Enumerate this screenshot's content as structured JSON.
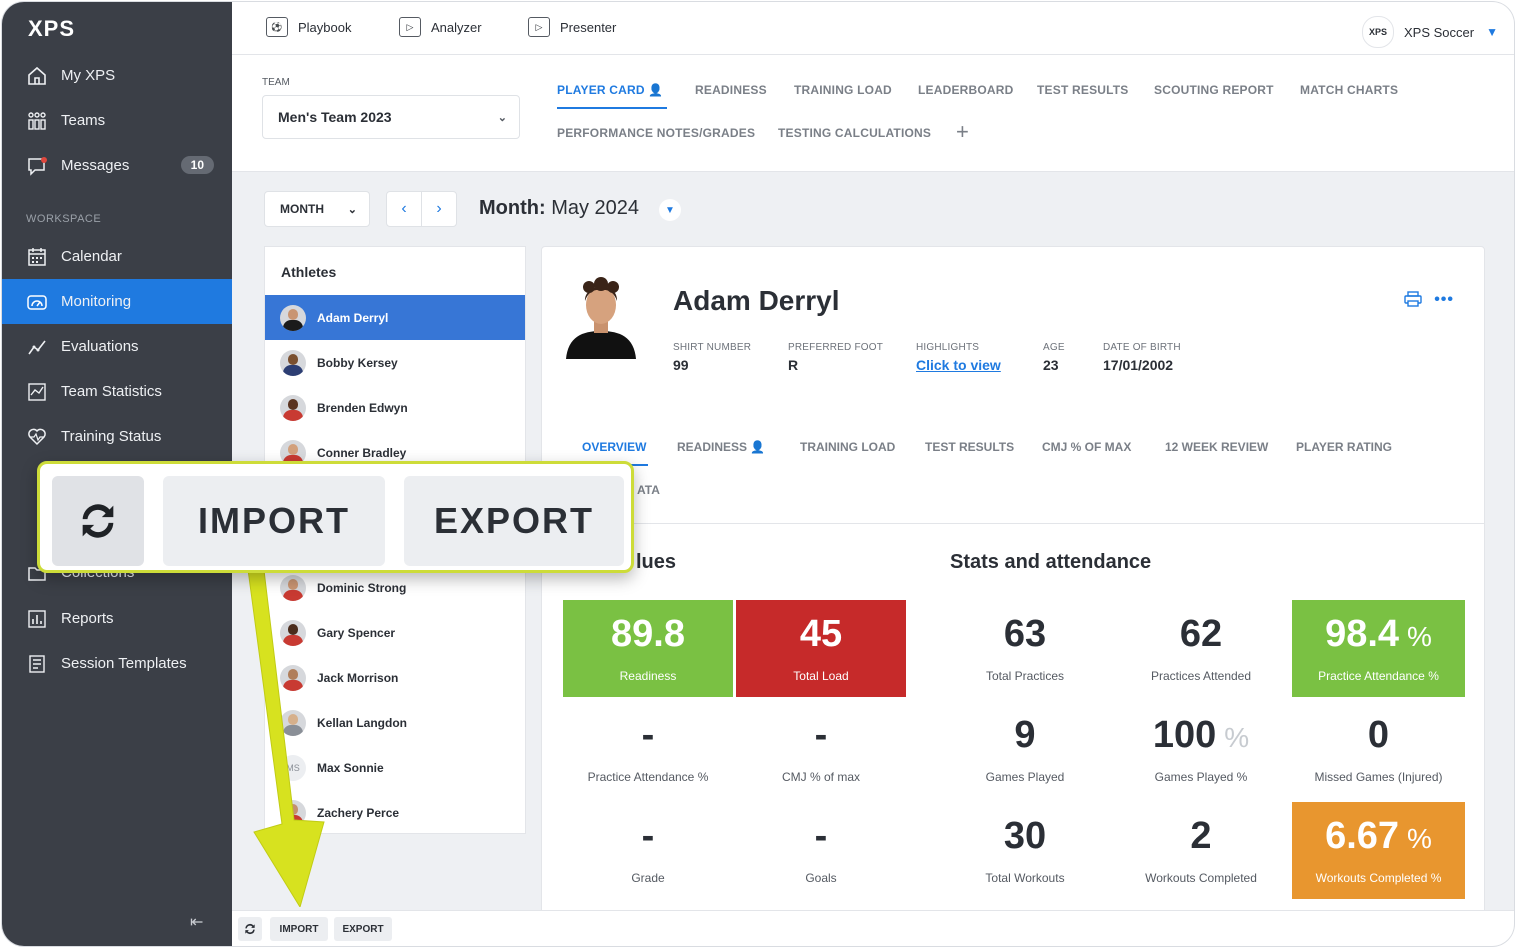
{
  "sidebar": {
    "logo": "XPS",
    "items": [
      {
        "label": "My XPS",
        "icon": "home-icon"
      },
      {
        "label": "Teams",
        "icon": "teams-icon"
      },
      {
        "label": "Messages",
        "icon": "messages-icon",
        "badge": "10"
      },
      {
        "label": "Calendar",
        "icon": "calendar-icon"
      },
      {
        "label": "Monitoring",
        "icon": "gauge-icon",
        "active": true
      },
      {
        "label": "Evaluations",
        "icon": "trend-icon"
      },
      {
        "label": "Team Statistics",
        "icon": "stats-icon"
      },
      {
        "label": "Training Status",
        "icon": "heart-icon"
      },
      {
        "label": "Collections",
        "icon": "folder-icon"
      },
      {
        "label": "Reports",
        "icon": "reports-icon"
      },
      {
        "label": "Session Templates",
        "icon": "templates-icon"
      }
    ],
    "workspace_label": "WORKSPACE",
    "collapse_icon": "collapse-icon"
  },
  "topbar": {
    "nav": [
      {
        "label": "Playbook",
        "icon": "playbook-icon"
      },
      {
        "label": "Analyzer",
        "icon": "analyzer-icon"
      },
      {
        "label": "Presenter",
        "icon": "presenter-icon"
      }
    ],
    "account": {
      "logo": "XPS",
      "name": "XPS Soccer"
    }
  },
  "team": {
    "label": "TEAM",
    "value": "Men's Team 2023"
  },
  "tabs": [
    {
      "label": "PLAYER CARD",
      "active": true
    },
    {
      "label": "READINESS"
    },
    {
      "label": "TRAINING LOAD"
    },
    {
      "label": "LEADERBOARD"
    },
    {
      "label": "TEST RESULTS"
    },
    {
      "label": "SCOUTING REPORT"
    },
    {
      "label": "MATCH CHARTS"
    },
    {
      "label": "PERFORMANCE NOTES/GRADES"
    },
    {
      "label": "TESTING CALCULATIONS"
    }
  ],
  "controls": {
    "period": "MONTH",
    "month_prefix": "Month:",
    "month_value": "May 2024"
  },
  "athletes": {
    "title": "Athletes",
    "list": [
      {
        "name": "Adam Derryl",
        "active": true
      },
      {
        "name": "Bobby Kersey"
      },
      {
        "name": "Brenden Edwyn"
      },
      {
        "name": "Conner Bradley"
      },
      {
        "name": "Dominic Strong"
      },
      {
        "name": "Gary Spencer"
      },
      {
        "name": "Jack Morrison"
      },
      {
        "name": "Kellan Langdon"
      },
      {
        "name": "Max Sonnie",
        "initials": "MS"
      },
      {
        "name": "Zachery Perce"
      }
    ]
  },
  "player": {
    "name": "Adam Derryl",
    "fields": [
      {
        "key": "SHIRT NUMBER",
        "value": "99"
      },
      {
        "key": "PREFERRED FOOT",
        "value": "R"
      },
      {
        "key": "HIGHLIGHTS",
        "value": "Click to view"
      },
      {
        "key": "AGE",
        "value": "23"
      },
      {
        "key": "DATE OF BIRTH",
        "value": "17/01/2002"
      }
    ],
    "tabs": [
      {
        "label": "OVERVIEW",
        "active": true
      },
      {
        "label": "READINESS"
      },
      {
        "label": "TRAINING LOAD"
      },
      {
        "label": "TEST RESULTS"
      },
      {
        "label": "CMJ % OF MAX"
      },
      {
        "label": "12 WEEK REVIEW"
      },
      {
        "label": "PLAYER RATING"
      },
      {
        "label": "ATA"
      }
    ],
    "values_title": "lues",
    "stats_title": "Stats and attendance",
    "values_tiles": [
      {
        "num": "89.8",
        "cap": "Readiness",
        "color": "#7ac143"
      },
      {
        "num": "45",
        "cap": "Total Load",
        "color": "#c62a2a"
      },
      {
        "num": "-",
        "cap": "Practice Attendance %"
      },
      {
        "num": "-",
        "cap": "CMJ % of max"
      },
      {
        "num": "-",
        "cap": "Grade"
      },
      {
        "num": "-",
        "cap": "Goals"
      }
    ],
    "stats_tiles": [
      {
        "num": "63",
        "cap": "Total Practices"
      },
      {
        "num": "62",
        "cap": "Practices Attended"
      },
      {
        "num": "98.4",
        "pct": "%",
        "cap": "Practice Attendance %",
        "color": "#7ac143"
      },
      {
        "num": "9",
        "cap": "Games Played"
      },
      {
        "num": "100",
        "pct": "%",
        "cap": "Games Played %"
      },
      {
        "num": "0",
        "cap": "Missed Games (Injured)"
      },
      {
        "num": "30",
        "cap": "Total Workouts"
      },
      {
        "num": "2",
        "cap": "Workouts Completed"
      },
      {
        "num": "6.67",
        "pct": "%",
        "cap": "Workouts Completed %",
        "color": "#e8962f"
      }
    ]
  },
  "bottombar": {
    "import": "IMPORT",
    "export": "EXPORT",
    "refresh_icon": "refresh-icon"
  },
  "callout": {
    "import": "IMPORT",
    "export": "EXPORT",
    "refresh_icon": "refresh-icon",
    "accent": "#cddc39"
  }
}
